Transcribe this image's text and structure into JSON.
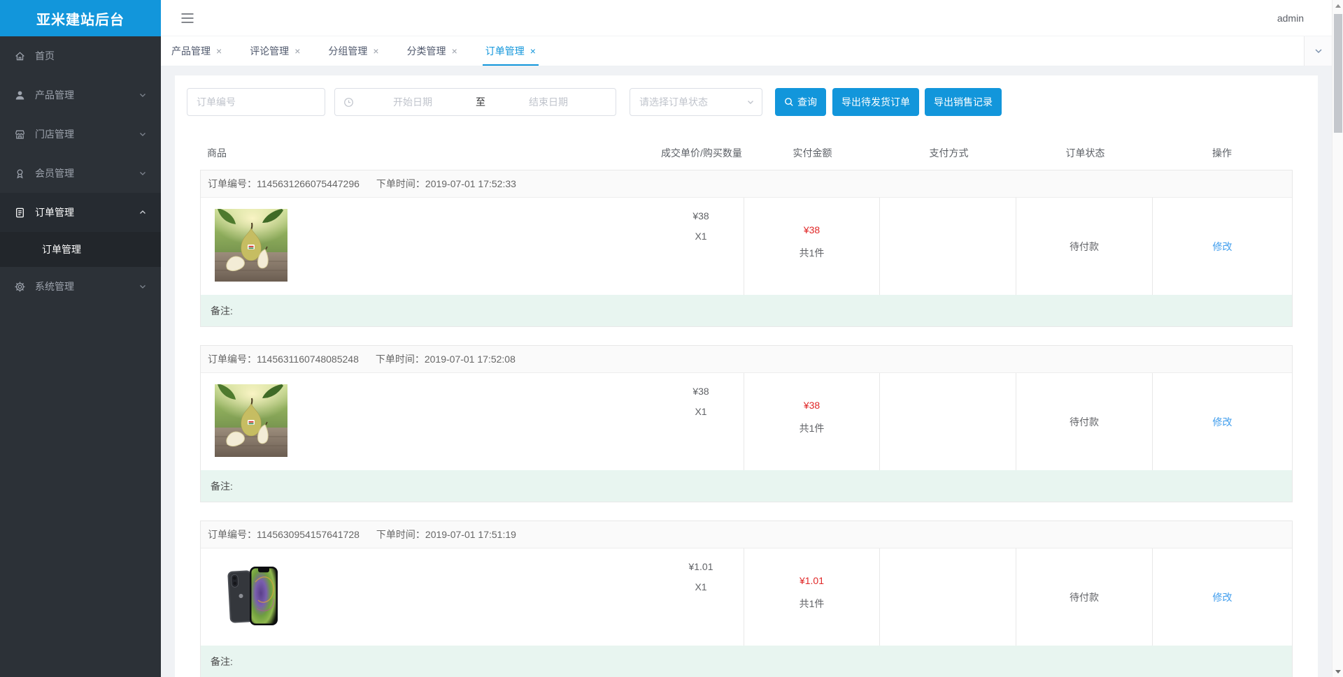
{
  "app": {
    "logo_title": "亚米建站后台",
    "user": "admin"
  },
  "colors": {
    "brand_blue": "#1296db",
    "price_red": "#e02727",
    "link_blue": "#3f9ded",
    "remark_bg": "#e8f5f0",
    "sidebar_bg": "#2c3137"
  },
  "icons": {
    "tab_close": "×",
    "hamburger": "hamburger-menu",
    "clock": "clock",
    "chevron_down": "chevron-down",
    "chevron_up": "chevron-up",
    "search": "magnifier"
  },
  "sidebar": {
    "items": [
      {
        "label": "首页",
        "icon": "home-icon"
      },
      {
        "label": "产品管理",
        "icon": "user-icon"
      },
      {
        "label": "门店管理",
        "icon": "store-icon"
      },
      {
        "label": "会员管理",
        "icon": "member-badge-icon"
      },
      {
        "label": "订单管理",
        "icon": "order-doc-icon",
        "expanded": true,
        "children": [
          {
            "label": "订单管理",
            "active": true
          }
        ]
      },
      {
        "label": "系统管理",
        "icon": "gear-icon"
      }
    ]
  },
  "tabs": [
    {
      "label": "产品管理"
    },
    {
      "label": "评论管理"
    },
    {
      "label": "分组管理"
    },
    {
      "label": "分类管理"
    },
    {
      "label": "订单管理",
      "active": true
    }
  ],
  "filters": {
    "order_no_placeholder": "订单编号",
    "date_start_placeholder": "开始日期",
    "date_separator": "至",
    "date_end_placeholder": "结束日期",
    "status_placeholder": "请选择订单状态",
    "search_label": "查询",
    "export_pending_label": "导出待发货订单",
    "export_sales_label": "导出销售记录"
  },
  "table": {
    "headers": [
      "商品",
      "成交单价/购买数量",
      "实付金额",
      "支付方式",
      "订单状态",
      "操作"
    ],
    "order_no_label": "订单编号：",
    "order_time_label": "下单时间：",
    "remark_label": "备注:",
    "orders": [
      {
        "order_no": "1145631266075447296",
        "order_time": "2019-07-01 17:52:33",
        "product": "pear",
        "unit_price": "¥38",
        "quantity": "X1",
        "paid_amount": "¥38",
        "paid_count": "共1件",
        "payment_method": "",
        "status": "待付款",
        "action": "修改",
        "remark": ""
      },
      {
        "order_no": "1145631160748085248",
        "order_time": "2019-07-01 17:52:08",
        "product": "pear",
        "unit_price": "¥38",
        "quantity": "X1",
        "paid_amount": "¥38",
        "paid_count": "共1件",
        "payment_method": "",
        "status": "待付款",
        "action": "修改",
        "remark": ""
      },
      {
        "order_no": "1145630954157641728",
        "order_time": "2019-07-01 17:51:19",
        "product": "iphone",
        "unit_price": "¥1.01",
        "quantity": "X1",
        "paid_amount": "¥1.01",
        "paid_count": "共1件",
        "payment_method": "",
        "status": "待付款",
        "action": "修改",
        "remark": ""
      }
    ]
  }
}
